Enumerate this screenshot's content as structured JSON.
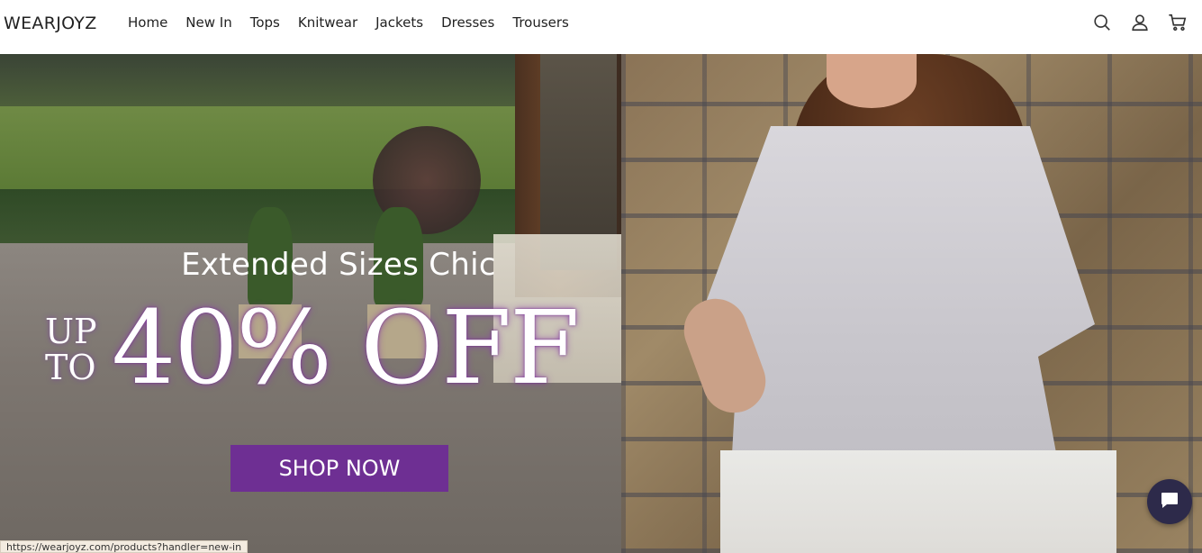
{
  "header": {
    "logo": "WEARJOYZ",
    "nav": [
      "Home",
      "New In",
      "Tops",
      "Knitwear",
      "Jackets",
      "Dresses",
      "Trousers"
    ],
    "icons": [
      "search-icon",
      "account-icon",
      "cart-icon"
    ]
  },
  "hero": {
    "eyebrow": "Extended Sizes Chic",
    "up": "UP",
    "to": "TO",
    "discount": "40% OFF",
    "cta": "SHOP NOW",
    "cta_color": "#6e2f93"
  },
  "chat": {
    "icon": "chat-icon"
  },
  "status_url": "https://wearjoyz.com/products?handler=new-in"
}
